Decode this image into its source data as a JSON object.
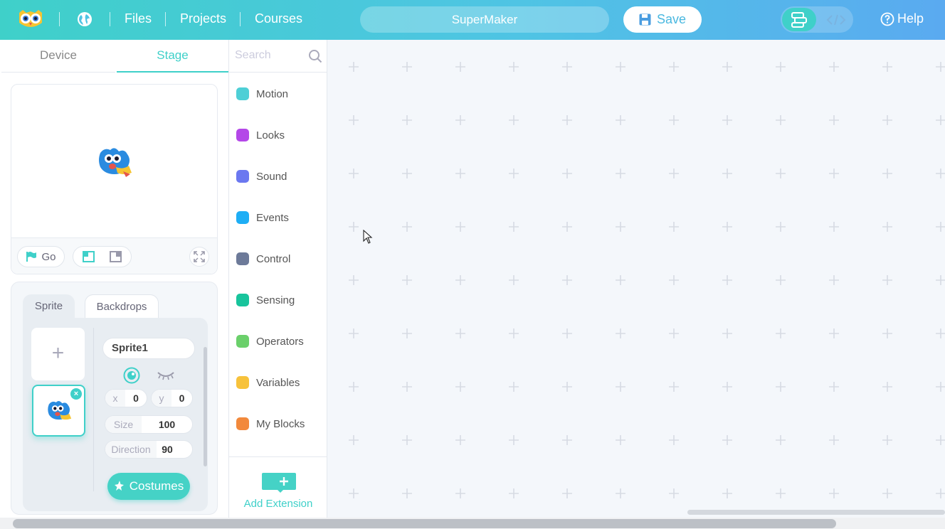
{
  "topbar": {
    "nav_files": "Files",
    "nav_projects": "Projects",
    "nav_courses": "Courses",
    "project_name": "SuperMaker",
    "save_label": "Save",
    "help_label": "Help"
  },
  "left_panel": {
    "tab_device": "Device",
    "tab_stage": "Stage",
    "go_label": "Go",
    "sprite_tab": "Sprite",
    "backdrops_tab": "Backdrops",
    "add_sprite_glyph": "+",
    "sprite_name": "Sprite1",
    "x_label": "x",
    "x_value": "0",
    "y_label": "y",
    "y_value": "0",
    "size_label": "Size",
    "size_value": "100",
    "direction_label": "Direction",
    "direction_value": "90",
    "costumes_label": "Costumes"
  },
  "categories": {
    "search_placeholder": "Search",
    "items": [
      {
        "label": "Motion",
        "color": "#4ecfd6"
      },
      {
        "label": "Looks",
        "color": "#b447e8"
      },
      {
        "label": "Sound",
        "color": "#6b78f0"
      },
      {
        "label": "Events",
        "color": "#1eaef5"
      },
      {
        "label": "Control",
        "color": "#6d7a99"
      },
      {
        "label": "Sensing",
        "color": "#18c49c"
      },
      {
        "label": "Operators",
        "color": "#6bd06b"
      },
      {
        "label": "Variables",
        "color": "#f7c23b"
      },
      {
        "label": "My Blocks",
        "color": "#f2893c"
      }
    ],
    "add_extension_label": "Add Extension"
  },
  "colors": {
    "accent": "#3fd0c9",
    "topbar_start": "#3fd0c9",
    "topbar_end": "#5aaaf0"
  }
}
